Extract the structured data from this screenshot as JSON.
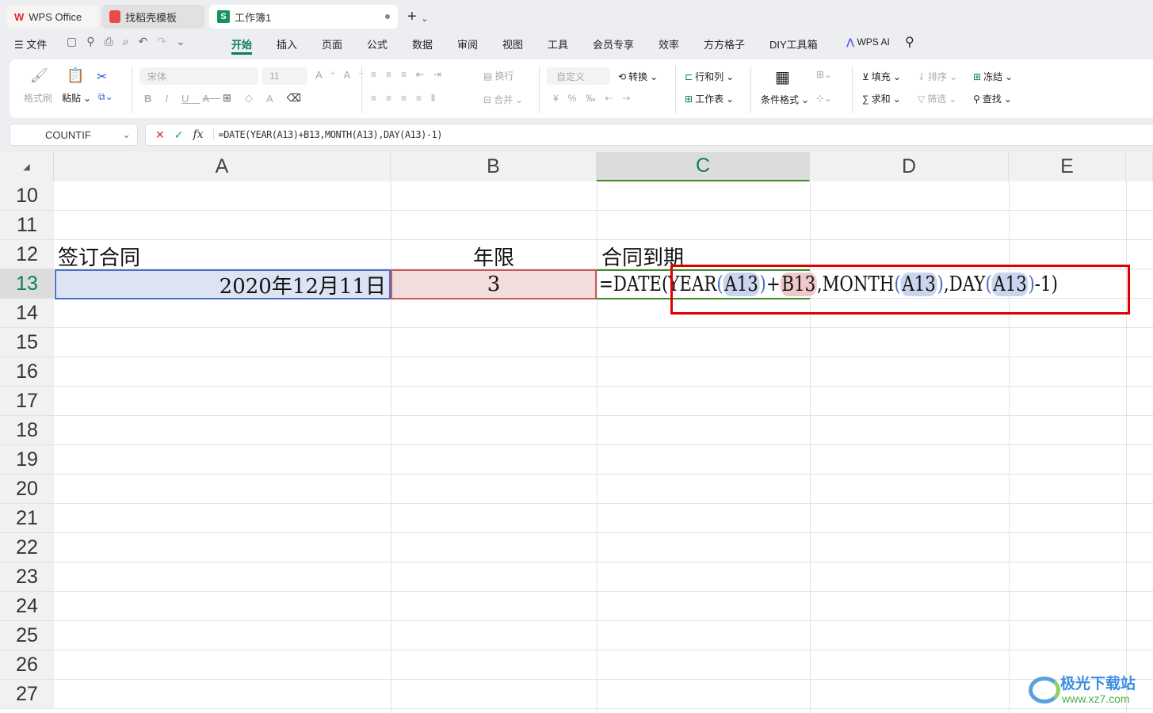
{
  "tabs": [
    {
      "label": "WPS Office"
    },
    {
      "label": "找稻壳模板"
    },
    {
      "label": "工作簿1"
    }
  ],
  "menu": {
    "file": "文件",
    "items": [
      "开始",
      "插入",
      "页面",
      "公式",
      "数据",
      "审阅",
      "视图",
      "工具",
      "会员专享",
      "效率",
      "方方格子",
      "DIY工具箱"
    ],
    "active": "开始",
    "ai": "WPS AI"
  },
  "ribbon": {
    "format_painter": "格式刷",
    "paste": "粘贴",
    "font": "宋体",
    "size": "11",
    "wrap": "换行",
    "merge": "合并",
    "number_format": "自定义",
    "convert": "转换",
    "rows_cols": "行和列",
    "worksheet": "工作表",
    "cond_format": "条件格式",
    "fill": "填充",
    "sort": "排序",
    "freeze": "冻结",
    "sum": "求和",
    "filter": "筛选",
    "find": "查找"
  },
  "formula_bar": {
    "name_box": "COUNTIF",
    "formula": "=DATE(YEAR(A13)+B13,MONTH(A13),DAY(A13)-1)"
  },
  "columns": [
    "A",
    "B",
    "C",
    "D",
    "E"
  ],
  "rows": [
    "10",
    "11",
    "12",
    "13",
    "14",
    "15",
    "16",
    "17",
    "18",
    "19",
    "20",
    "21",
    "22",
    "23",
    "24",
    "25",
    "26",
    "27"
  ],
  "cells": {
    "A12": "签订合同",
    "B12": "年限",
    "C12": "合同到期",
    "A13": "2020年12月11日",
    "B13": "3",
    "C13": {
      "p1": "=DATE(",
      "p2": "YEAR",
      "p3": "(",
      "p4": "A13",
      "p5": ")",
      "p6": "+",
      "p7": "B13",
      "p8": ",",
      "p9": "MONTH",
      "p10": "(",
      "p11": "A13",
      "p12": ")",
      "p13": ",",
      "p14": "DAY",
      "p15": "(",
      "p16": "A13",
      "p17": ")",
      "p18": "-1)"
    }
  },
  "watermark": {
    "name": "极光下载站",
    "url": "www.xz7.com"
  },
  "colors": {
    "accent": "#0f7b5f",
    "highlight": "#e00000"
  }
}
